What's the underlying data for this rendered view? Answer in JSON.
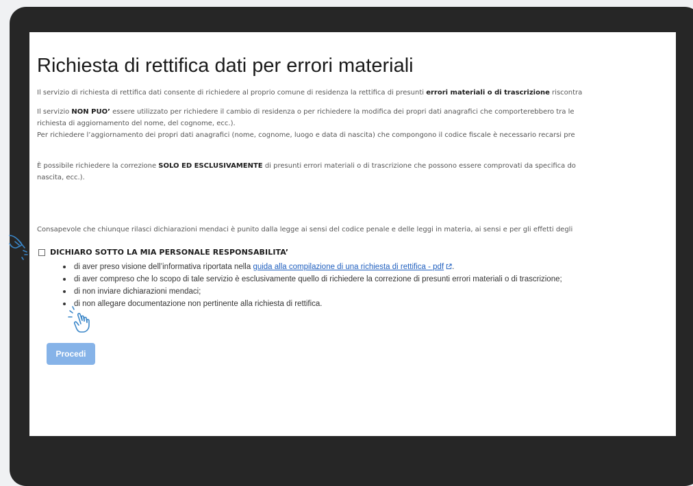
{
  "page": {
    "title": "Richiesta di rettifica dati per errori materiali",
    "p1": {
      "text": "Il servizio di richiesta di rettifica dati consente di richiedere al proprio comune di residenza la rettifica di presunti ",
      "bold": "errori materiali o di trascrizione",
      "tail": " riscontra"
    },
    "p2": {
      "pre": "Il servizio ",
      "bold": "NON PUO’",
      "line1": " essere utilizzato per richiedere il cambio di residenza o per richiedere la modifica dei propri dati anagrafici che comporterebbero tra le",
      "line2": "richiesta di aggiornamento del nome, del cognome, ecc.).",
      "line3": "Per richiedere l’aggiornamento dei propri dati anagrafici (nome, cognome, luogo e data di nascita) che compongono il codice fiscale è necessario recarsi pre"
    },
    "p3": {
      "pre": "È possibile richiedere la correzione ",
      "bold": "SOLO ED ESCLUSIVAMENTE",
      "line1": " di presunti errori materiali o di trascrizione che possono essere comprovati da specifica do",
      "line2": "nascita, ecc.)."
    },
    "p4": "Consapevole che chiunque rilasci dichiarazioni mendaci è punito dalla legge ai sensi del codice penale e delle leggi in materia, ai sensi e per gli effetti degli ",
    "declaration": {
      "label": "DICHIARO SOTTO LA MIA PERSONALE RESPONSABILITA’",
      "items": [
        {
          "pre": "di aver preso visione dell’informativa riportata nella ",
          "link": "guida alla compilazione di una richiesta di rettifica - pdf",
          "post": "."
        },
        {
          "text": "di aver compreso che lo scopo di tale servizio è esclusivamente quello di richiedere la correzione di presunti errori materiali o di trascrizione;"
        },
        {
          "text": "di non inviare dichiarazioni mendaci;"
        },
        {
          "text": "di non allegare documentazione non pertinente alla richiesta di rettifica."
        }
      ]
    },
    "button": "Procedi"
  },
  "colors": {
    "frame": "#262626",
    "background": "#f0f1f3",
    "link": "#1f5fbf",
    "button": "#86b3e8",
    "hand_icon": "#3a86c8"
  },
  "icons": [
    "external-link-icon",
    "pointing-hand-icon"
  ]
}
